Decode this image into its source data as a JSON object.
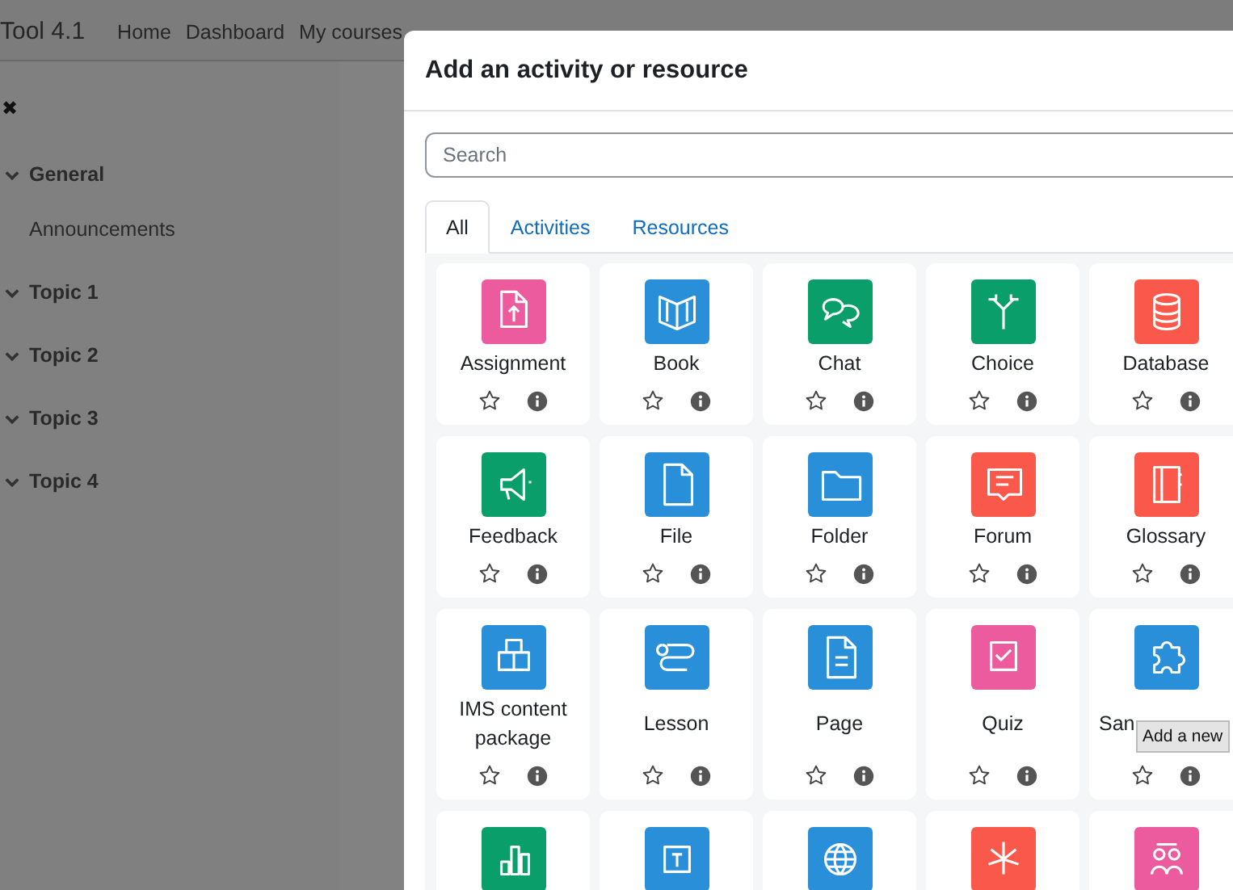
{
  "navbar": {
    "brand": "Tool 4.1",
    "links": [
      "Home",
      "Dashboard",
      "My courses"
    ]
  },
  "sidebar": {
    "close": "✖",
    "sections": [
      {
        "title": "General",
        "expanded": true,
        "children": [
          "Announcements"
        ]
      },
      {
        "title": "Topic 1",
        "expanded": true
      },
      {
        "title": "Topic 2",
        "expanded": true
      },
      {
        "title": "Topic 3",
        "expanded": true
      },
      {
        "title": "Topic 4",
        "expanded": true
      }
    ]
  },
  "modal": {
    "title": "Add an activity or resource",
    "search": {
      "placeholder": "Search"
    },
    "tabs": [
      {
        "label": "All",
        "selected": true
      },
      {
        "label": "Activities",
        "selected": false
      },
      {
        "label": "Resources",
        "selected": false
      }
    ],
    "items": [
      {
        "label": "Assignment",
        "color": "#eb5b9d",
        "starred": false
      },
      {
        "label": "Book",
        "color": "#2a8fd9",
        "starred": false
      },
      {
        "label": "Chat",
        "color": "#0a9e6b",
        "starred": false
      },
      {
        "label": "Choice",
        "color": "#0a9e6b",
        "starred": false
      },
      {
        "label": "Database",
        "color": "#f9584a",
        "starred": false
      },
      {
        "label": "Feedback",
        "color": "#0a9e6b",
        "starred": false
      },
      {
        "label": "File",
        "color": "#2a8fd9",
        "starred": false
      },
      {
        "label": "Folder",
        "color": "#2a8fd9",
        "starred": false
      },
      {
        "label": "Forum",
        "color": "#f9584a",
        "starred": false
      },
      {
        "label": "Glossary",
        "color": "#f9584a",
        "starred": false
      },
      {
        "label": "IMS content package",
        "color": "#2a8fd9",
        "starred": false
      },
      {
        "label": "Lesson",
        "color": "#2a8fd9",
        "starred": false
      },
      {
        "label": "Page",
        "color": "#2a8fd9",
        "starred": false
      },
      {
        "label": "Quiz",
        "color": "#eb5b9d",
        "starred": false
      },
      {
        "label": "San",
        "color": "#2a8fd9",
        "starred": false
      },
      {
        "color": "#0a9e6b"
      },
      {
        "color": "#2a8fd9"
      },
      {
        "color": "#2a8fd9"
      },
      {
        "color": "#f9584a"
      },
      {
        "color": "#eb5b9d"
      }
    ],
    "tooltip": "Add a new"
  }
}
